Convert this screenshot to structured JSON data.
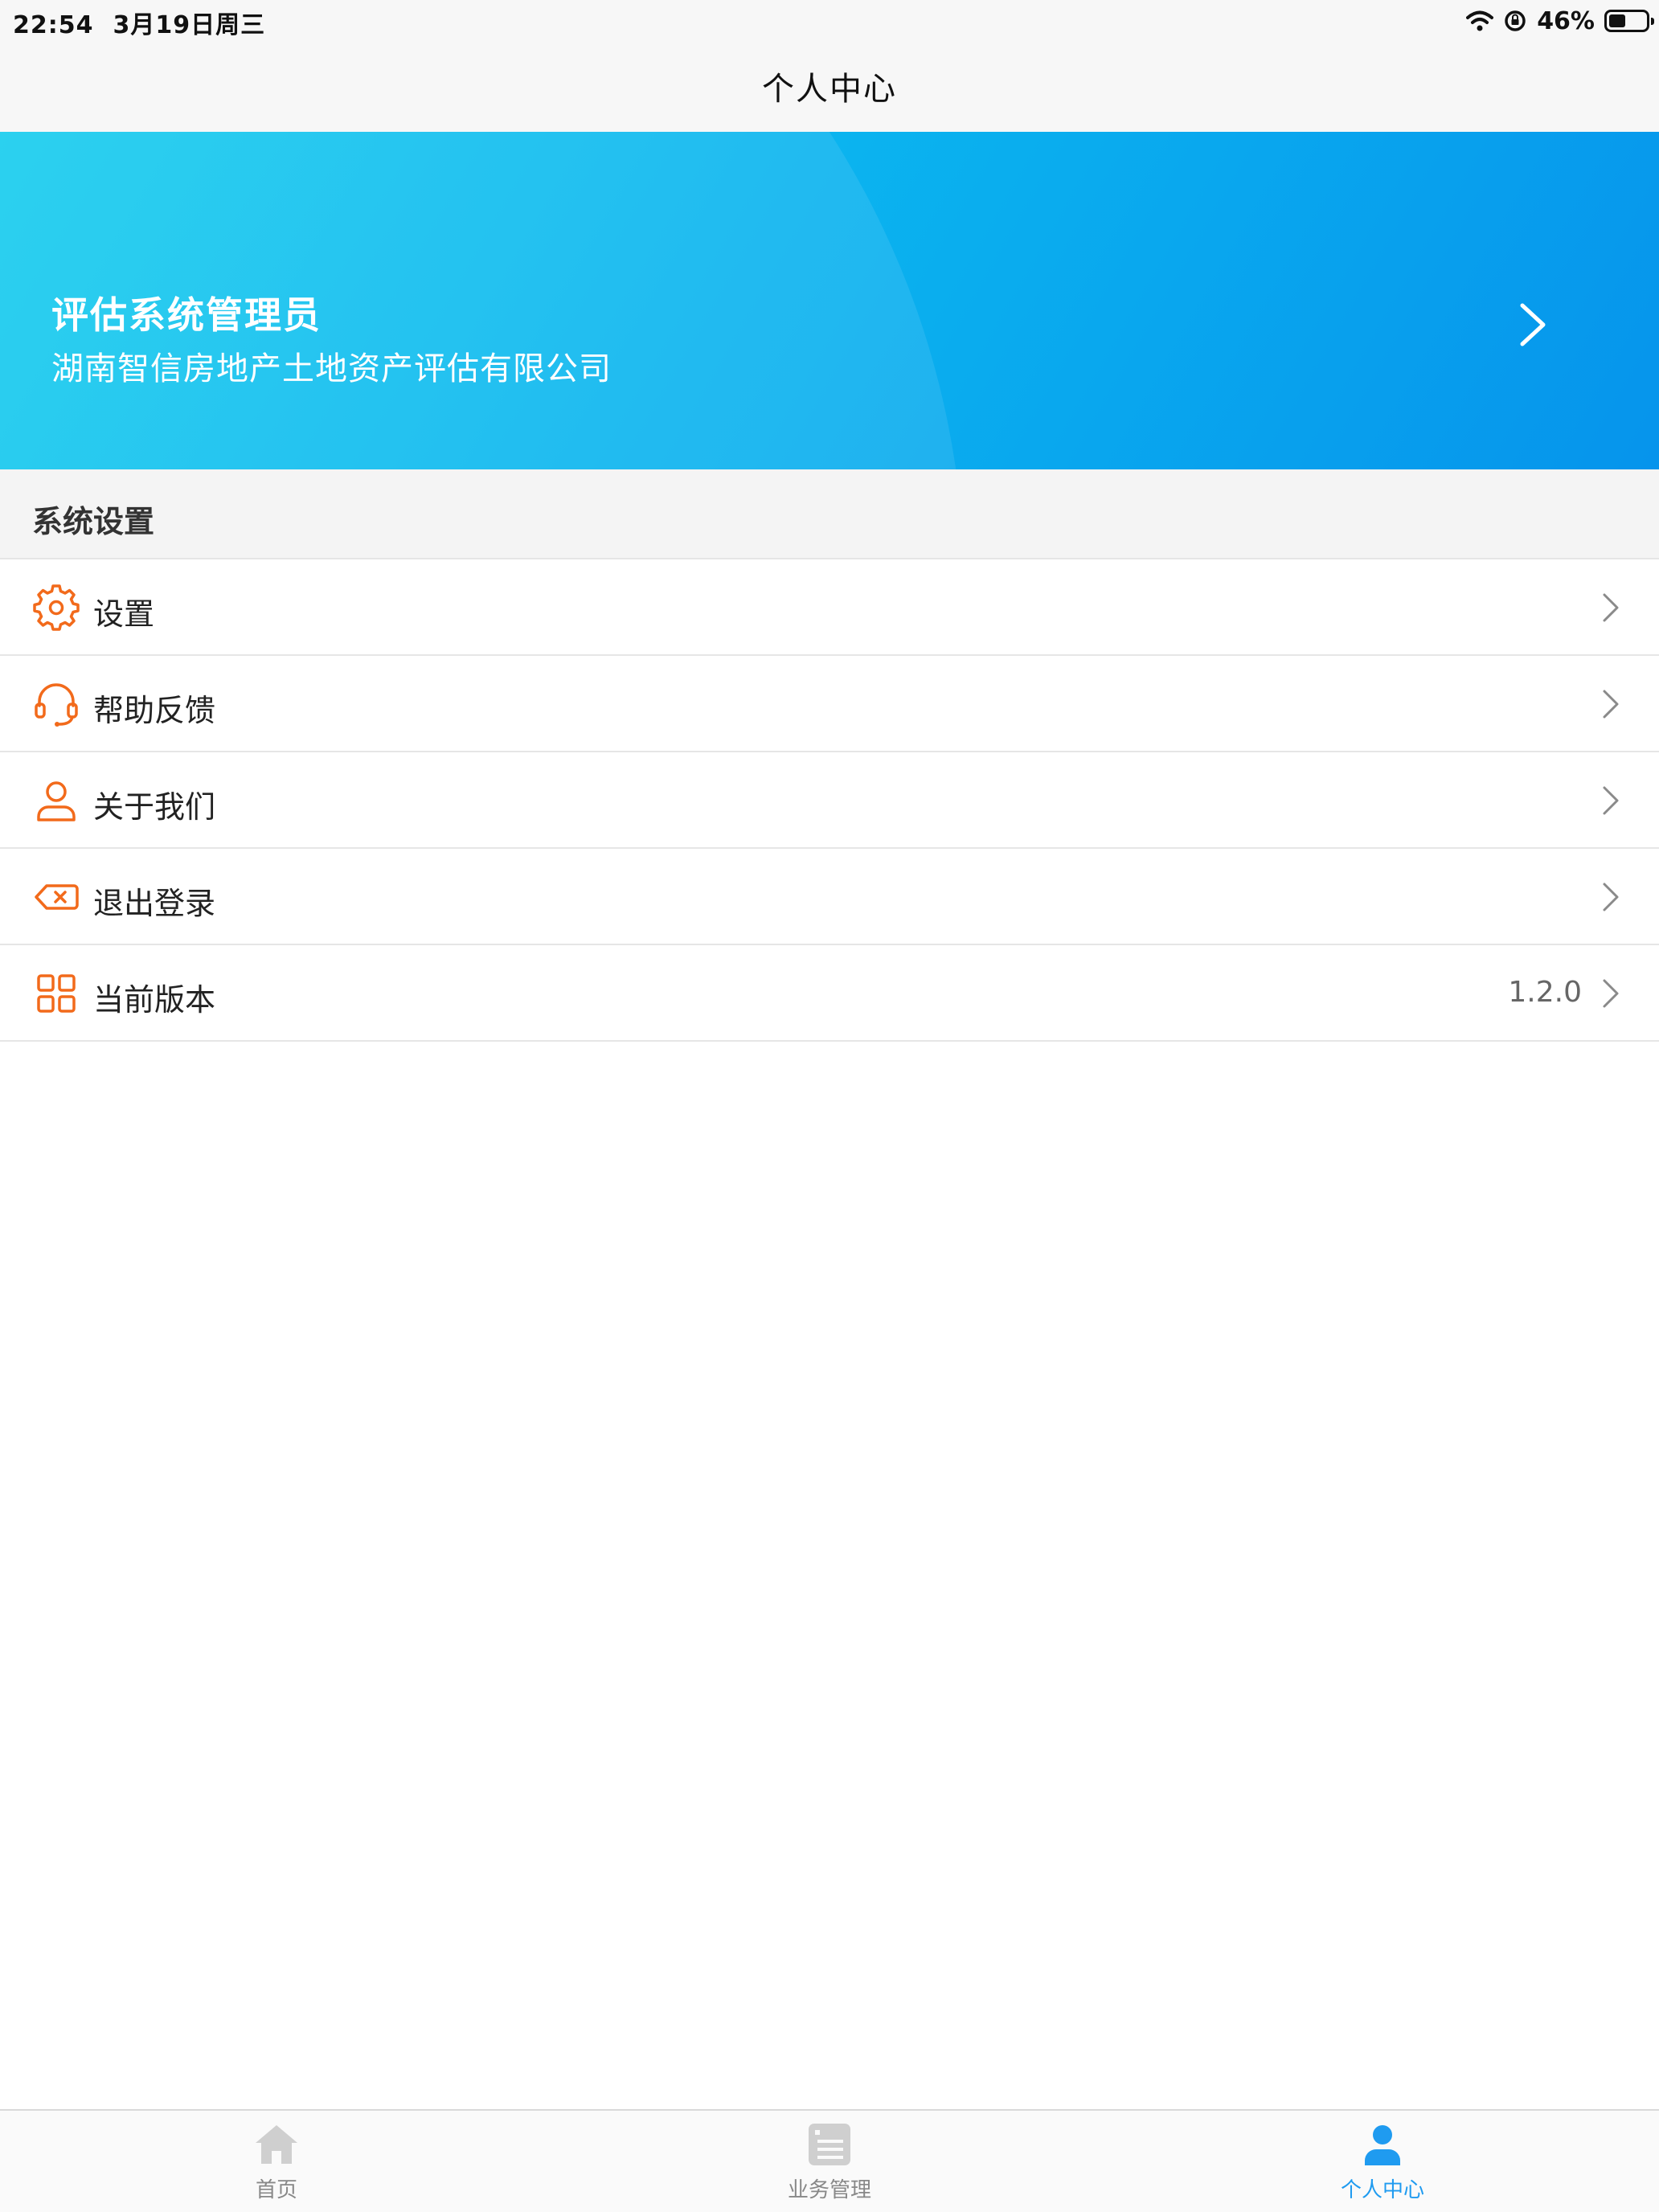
{
  "status_bar": {
    "time": "22:54",
    "date": "3月19日周三",
    "battery_percent": "46%",
    "battery_level": 0.46,
    "icons": [
      "wifi-icon",
      "rotation-lock-icon",
      "battery-icon"
    ]
  },
  "nav": {
    "title": "个人中心"
  },
  "profile": {
    "name": "评估系统管理员",
    "company": "湖南智信房地产土地资产评估有限公司"
  },
  "section": {
    "title": "系统设置"
  },
  "menu": {
    "items": [
      {
        "label": "设置",
        "icon": "gear-icon"
      },
      {
        "label": "帮助反馈",
        "icon": "headset-icon"
      },
      {
        "label": "关于我们",
        "icon": "user-icon"
      },
      {
        "label": "退出登录",
        "icon": "logout-icon"
      },
      {
        "label": "当前版本",
        "icon": "grid-icon",
        "value": "1.2.0"
      }
    ]
  },
  "tabs": [
    {
      "label": "首页",
      "icon": "home-icon",
      "active": false
    },
    {
      "label": "业务管理",
      "icon": "list-icon",
      "active": false
    },
    {
      "label": "个人中心",
      "icon": "profile-icon",
      "active": true
    }
  ],
  "colors": {
    "accent": "#1f9bf0",
    "icon_orange": "#f26a1b",
    "banner_start": "#17cdee",
    "banner_end": "#0694ec",
    "tab_inactive": "#cfcfcf"
  }
}
